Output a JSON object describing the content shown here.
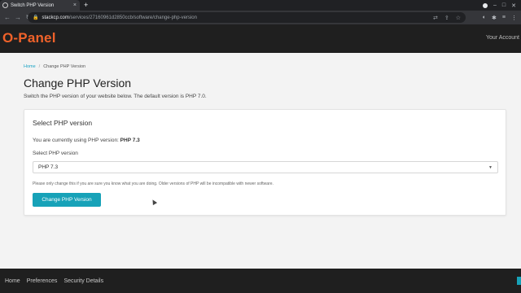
{
  "browser": {
    "tab_title": "Switch PHP Version",
    "tab_close": "×",
    "new_tab": "+",
    "url_host": "stackcp.com",
    "url_path": "/services/27160961d2850ccb/software/change-php-version"
  },
  "header": {
    "logo": "O-Panel",
    "account": "Your Account"
  },
  "breadcrumb": {
    "home": "Home",
    "separator": "/",
    "current": "Change PHP Version"
  },
  "page": {
    "title": "Change PHP Version",
    "subtitle": "Switch the PHP version of your website below. The default version is PHP 7.0."
  },
  "card": {
    "title": "Select PHP version",
    "current_prefix": "You are currently using PHP version: ",
    "current_version": "PHP 7.3",
    "select_label": "Select PHP version",
    "selected_value": "PHP 7.3",
    "note": "Please only change this if you are sure you know what you are doing. Older versions of PHP will be incompatible with newer software.",
    "button_label": "Change PHP Version"
  },
  "footer": {
    "links": [
      "Home",
      "Preferences",
      "Security Details"
    ]
  },
  "colors": {
    "accent": "#17a2b8",
    "logo": "#f0622a",
    "header_bg": "#1f1f1f"
  }
}
